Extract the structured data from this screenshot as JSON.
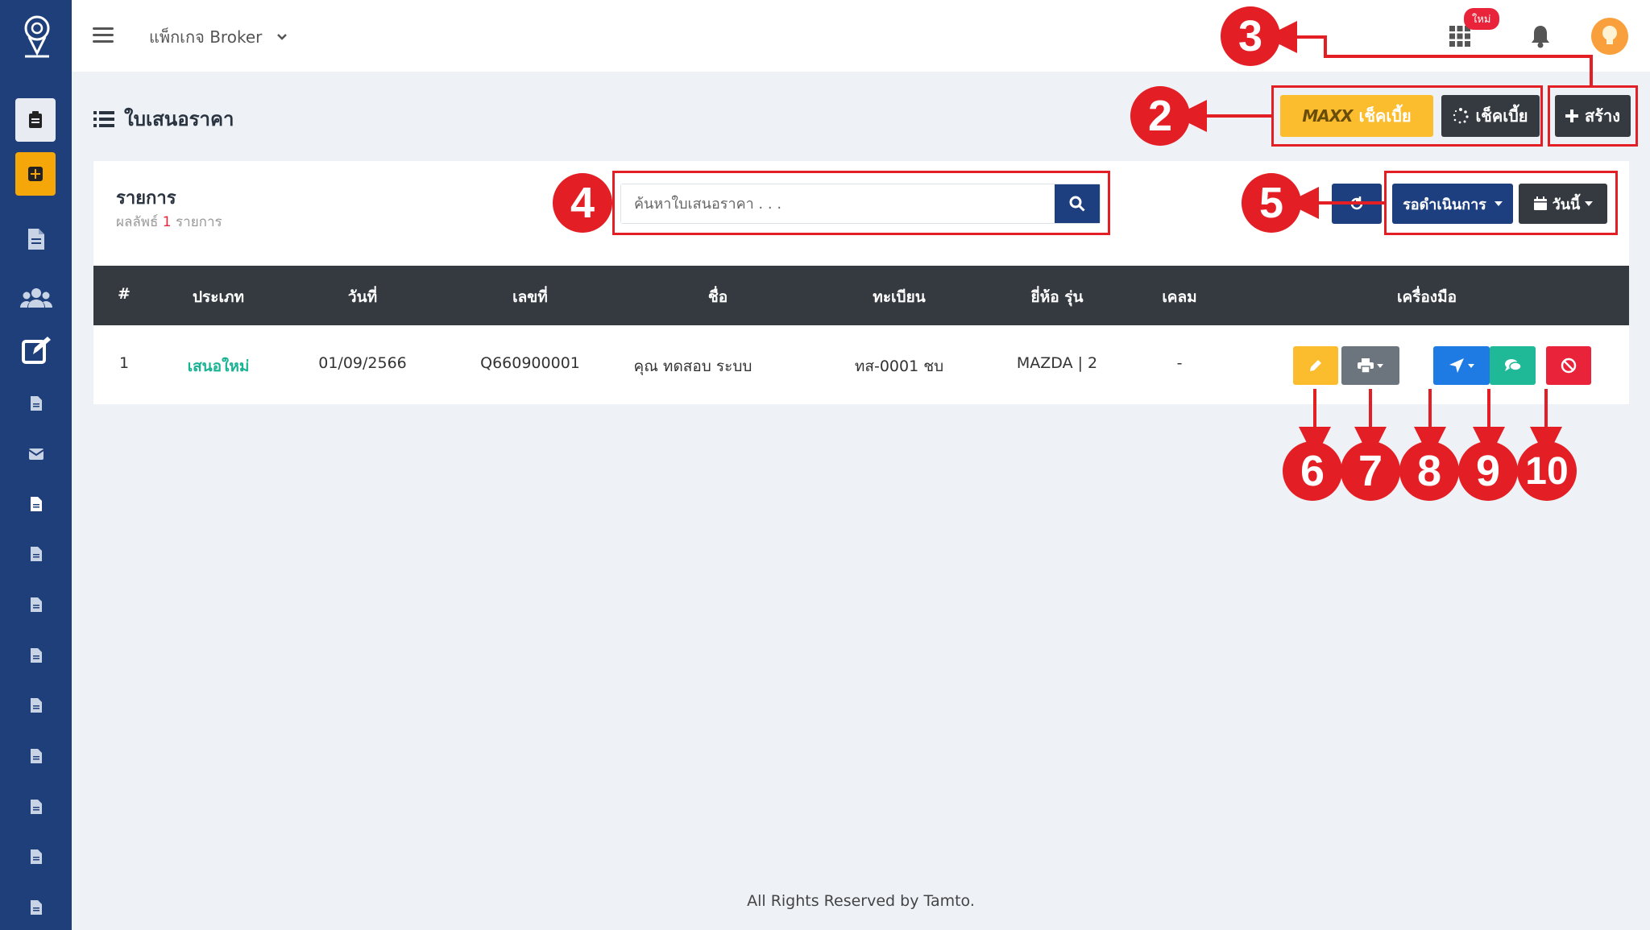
{
  "topbar": {
    "package_label": "แพ็กเกจ Broker",
    "new_badge": "ใหม่"
  },
  "header": {
    "title": "ใบเสนอราคา",
    "btn_maxx_logo": "MAXX",
    "btn_maxx_label": "เช็คเบี้ย",
    "btn_check_label": "เช็คเบี้ย",
    "btn_create_label": "สร้าง"
  },
  "list": {
    "title": "รายการ",
    "result_prefix": "ผลลัพธ์",
    "result_count": "1",
    "result_suffix": "รายการ",
    "search_placeholder": "ค้นหาใบเสนอราคา . . .",
    "status_filter": "รอดำเนินการ",
    "date_filter": "วันนี้"
  },
  "table": {
    "columns": [
      "#",
      "ประเภท",
      "วันที่",
      "เลขที่",
      "ชื่อ",
      "ทะเบียน",
      "ยี่ห้อ รุ่น",
      "เคลม",
      "เครื่องมือ"
    ],
    "rows": [
      {
        "index": "1",
        "type": "เสนอใหม่",
        "date": "01/09/2566",
        "number": "Q660900001",
        "name": "คุณ ทดสอบ ระบบ",
        "plate": "ทส-0001 ชบ",
        "brand_model": "MAZDA | 2",
        "claim": "-"
      }
    ]
  },
  "annotations": [
    "2",
    "3",
    "4",
    "5",
    "6",
    "7",
    "8",
    "9",
    "10"
  ],
  "footer": "All Rights Reserved by Tamto.",
  "colors": {
    "sidebar": "#1e3f7a",
    "primary": "#1d3f7f",
    "dark": "#343a40",
    "warning": "#fbbd2e",
    "success": "#20b998",
    "danger": "#e8233a",
    "info": "#1e7be3",
    "annotation": "#e31e24"
  }
}
